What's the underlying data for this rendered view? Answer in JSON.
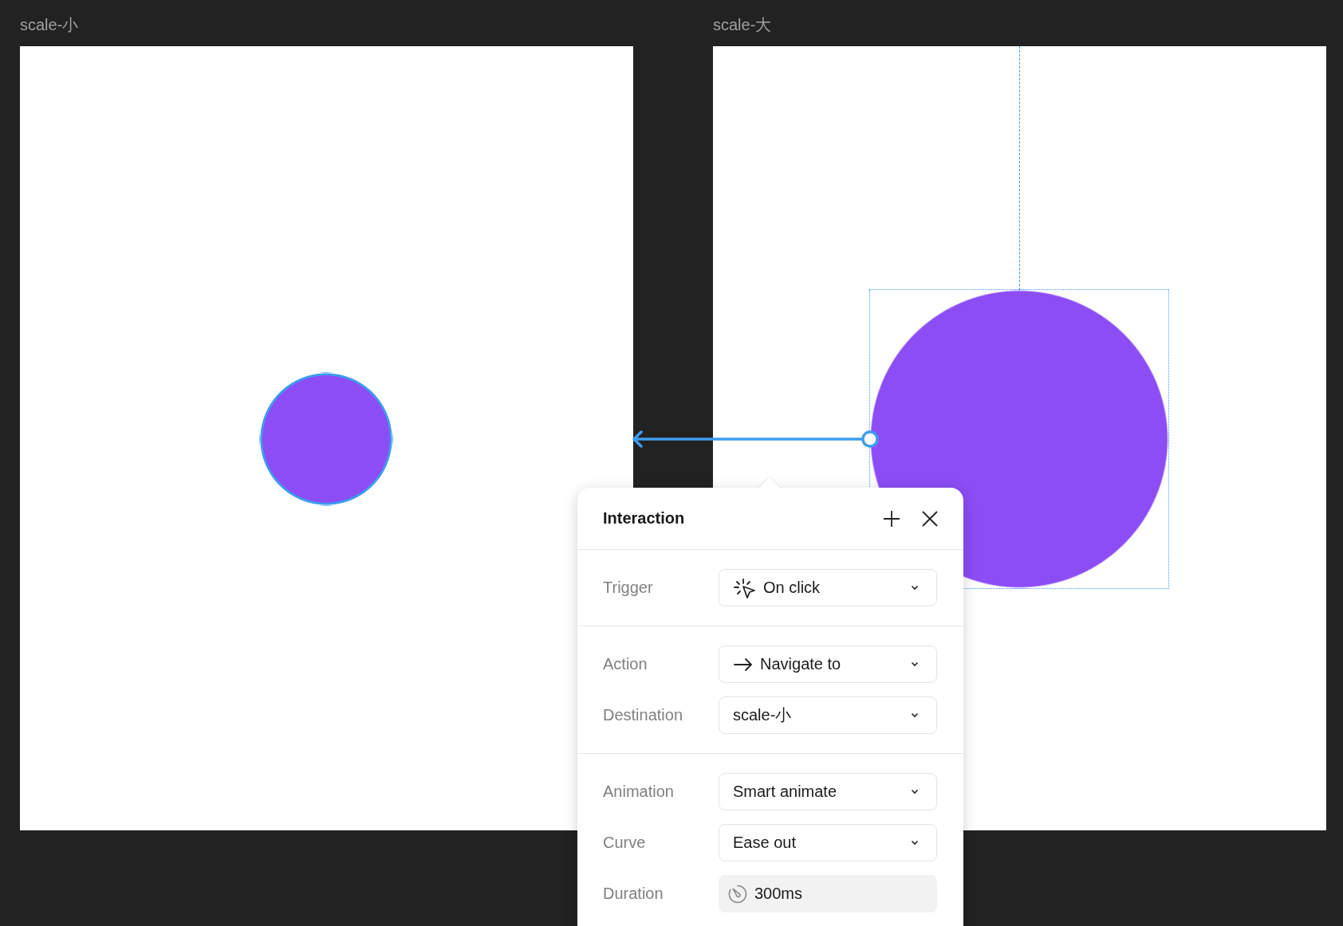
{
  "canvas": {
    "frames": [
      {
        "title": "scale-小",
        "circle": {
          "selected": false,
          "highlighted": true
        }
      },
      {
        "title": "scale-大",
        "circle": {
          "selected": true,
          "highlighted": false
        }
      }
    ]
  },
  "interaction_panel": {
    "title": "Interaction",
    "sections": [
      [
        {
          "label": "Trigger",
          "value": "On click",
          "kind": "trigger"
        }
      ],
      [
        {
          "label": "Action",
          "value": "Navigate to",
          "kind": "action"
        },
        {
          "label": "Destination",
          "value": "scale-小",
          "kind": "select"
        }
      ],
      [
        {
          "label": "Animation",
          "value": "Smart animate",
          "kind": "select"
        },
        {
          "label": "Curve",
          "value": "Ease out",
          "kind": "select"
        },
        {
          "label": "Duration",
          "value": "300ms",
          "kind": "duration"
        }
      ]
    ]
  }
}
